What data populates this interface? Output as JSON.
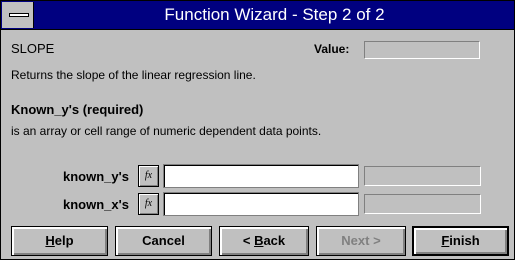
{
  "window": {
    "title": "Function Wizard - Step 2 of 2"
  },
  "function": {
    "name": "SLOPE",
    "value_label": "Value:",
    "value": "",
    "description": "Returns the slope of the linear regression line."
  },
  "argument_help": {
    "title": "Known_y's (required)",
    "description": "is an array or cell range of numeric dependent data points."
  },
  "arguments": [
    {
      "label": "known_y's",
      "fx_label": "fx",
      "value": "",
      "result": ""
    },
    {
      "label": "known_x's",
      "fx_label": "fx",
      "value": "",
      "result": ""
    }
  ],
  "buttons": {
    "help": {
      "label_prefix": "",
      "mnemonic": "H",
      "label_rest": "elp"
    },
    "cancel": {
      "label": "Cancel"
    },
    "back": {
      "arrow": "<",
      "mnemonic": "B",
      "label_rest": "ack"
    },
    "next": {
      "label": "Next >",
      "disabled": true
    },
    "finish": {
      "mnemonic": "F",
      "label_rest": "inish"
    }
  }
}
